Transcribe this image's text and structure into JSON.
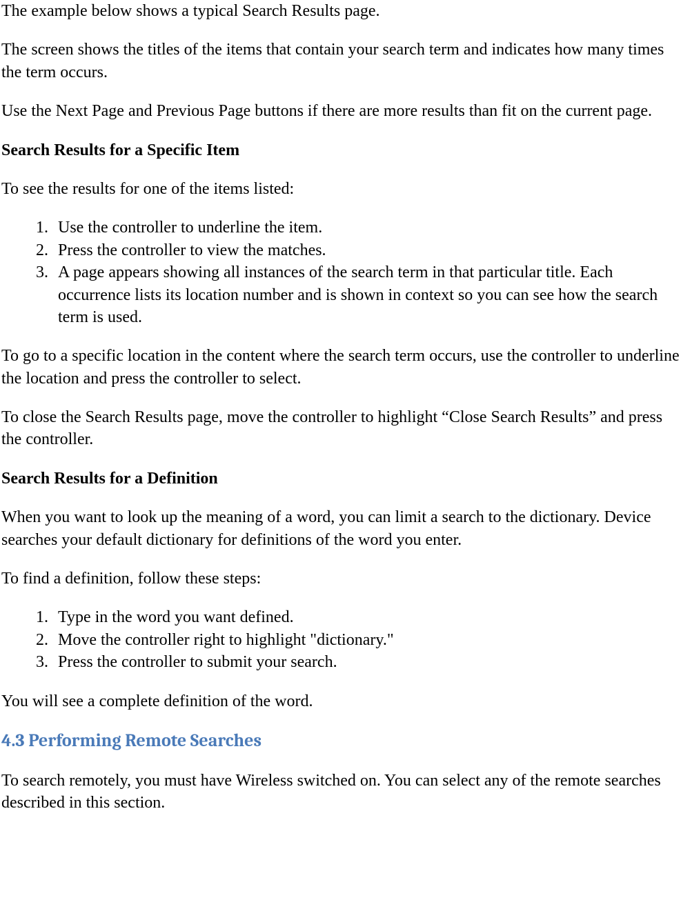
{
  "p1": "The example below shows a typical Search Results page.",
  "p2": "The screen shows the titles of the items that contain your search term and indicates how many times the term occurs.",
  "p3": "Use the Next Page and Previous Page buttons if there are more results than fit on the current page.",
  "h1": "Search Results for a Specific Item",
  "p4": "To see the results for one of the items listed:",
  "list1": {
    "i1": "Use the controller to underline the item.",
    "i2": "Press the controller to view the matches.",
    "i3": "A page appears showing all instances of the search term in that particular title. Each occurrence lists its location number and is shown in context so you can see how the search term is used."
  },
  "p5": "To go to a specific location in the content where the search term occurs, use the controller to underline the location and press the controller to select.",
  "p6": "To close the Search Results page, move the controller to highlight “Close Search Results” and press the controller.",
  "h2": "Search Results for a Definition",
  "p7": "When you want to look up the meaning of a word, you can limit a search to the dictionary. Device searches your default dictionary for definitions of the word you enter.",
  "p8": "To find a definition, follow these steps:",
  "list2": {
    "i1": "Type in the word you want defined.",
    "i2": "Move the controller right to highlight \"dictionary.\"",
    "i3": "Press the controller to submit your search."
  },
  "p9": "You will see a complete definition of the word.",
  "h3": "4.3 Performing Remote Searches",
  "p10": "To search remotely, you must have Wireless switched on. You can select any of the remote searches described in this section."
}
